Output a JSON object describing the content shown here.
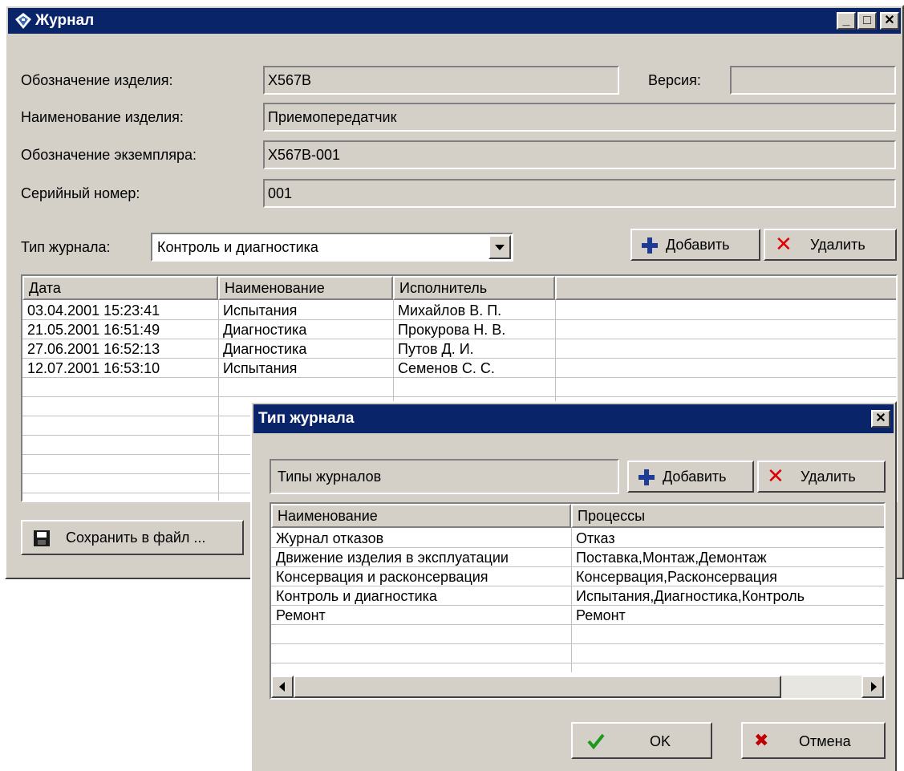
{
  "main_window": {
    "title": "Журнал",
    "minimize": "_",
    "maximize": "□",
    "close": "✕"
  },
  "form": {
    "product_designation_label": "Обозначение изделия:",
    "product_designation_value": "X567B",
    "version_label": "Версия:",
    "version_value": "",
    "product_name_label": "Наименование изделия:",
    "product_name_value": "Приемопередатчик",
    "instance_designation_label": "Обозначение экземпляра:",
    "instance_designation_value": "X567B-001",
    "serial_label": "Серийный номер:",
    "serial_value": "001",
    "journal_type_label": "Тип журнала:",
    "journal_type_value": "Контроль и диагностика"
  },
  "toolbar": {
    "add_label": "Добавить",
    "delete_label": "Удалить"
  },
  "journal_table": {
    "columns": [
      "Дата",
      "Наименование",
      "Исполнитель"
    ],
    "rows": [
      [
        "03.04.2001  15:23:41",
        "Испытания",
        "Михайлов В. П."
      ],
      [
        "21.05.2001  16:51:49",
        "Диагностика",
        "Прокурова Н. В."
      ],
      [
        "27.06.2001  16:52:13",
        "Диагностика",
        "Путов Д. И."
      ],
      [
        "12.07.2001  16:53:10",
        "Испытания",
        "Семенов С. С."
      ]
    ]
  },
  "save_button_label": "Сохранить в файл ...",
  "dialog": {
    "title": "Тип журнала",
    "close": "✕",
    "group_label": "Типы журналов",
    "add_label": "Добавить",
    "delete_label": "Удалить",
    "columns": [
      "Наименование",
      "Процессы"
    ],
    "rows": [
      [
        "Журнал отказов",
        "Отказ"
      ],
      [
        "Движение изделия в эксплуатации",
        "Поставка,Монтаж,Демонтаж"
      ],
      [
        "Консервация и расконсервация",
        "Консервация,Расконсервация"
      ],
      [
        "Контроль и диагностика",
        "Испытания,Диагностика,Контроль"
      ],
      [
        "Ремонт",
        "Ремонт"
      ]
    ],
    "ok_label": "OK",
    "cancel_label": "Отмена"
  },
  "colors": {
    "titlebar": "#0a246a",
    "face": "#d4d0c8",
    "plus": "#1e3c96",
    "delete": "#e00000",
    "ok": "#1a9a1a"
  }
}
